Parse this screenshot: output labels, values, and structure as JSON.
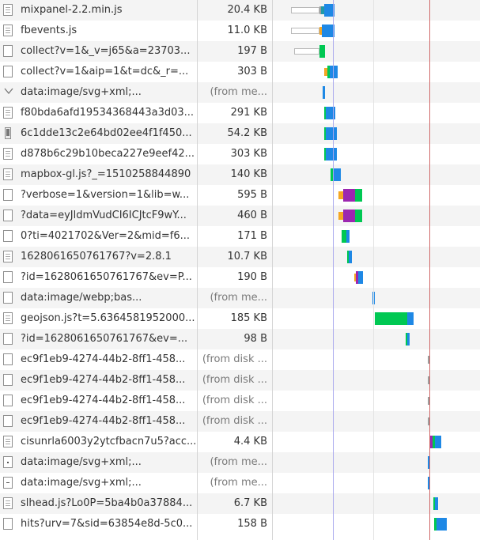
{
  "requests": [
    {
      "name": "mixpanel-2.2.min.js",
      "size": "20.4 KB",
      "icon": "doc-icon"
    },
    {
      "name": "fbevents.js",
      "size": "11.0 KB",
      "icon": "doc-icon"
    },
    {
      "name": "collect?v=1&_v=j65&a=23703...",
      "size": "197 B",
      "icon": "file-icon"
    },
    {
      "name": "collect?v=1&aip=1&t=dc&_r=...",
      "size": "303 B",
      "icon": "file-icon"
    },
    {
      "name": "data:image/svg+xml;...",
      "size": "(from me...",
      "icon": "chevron-down-icon"
    },
    {
      "name": "f80bda6afd19534368443a3d03...",
      "size": "291 KB",
      "icon": "doc-icon"
    },
    {
      "name": "6c1dde13c2e64bd02ee4f1f450...",
      "size": "54.2 KB",
      "icon": "phone-icon"
    },
    {
      "name": "d878b6c29b10beca227e9eef42...",
      "size": "303 KB",
      "icon": "doc-icon"
    },
    {
      "name": "mapbox-gl.js?_=1510258844890",
      "size": "140 KB",
      "icon": "doc-icon"
    },
    {
      "name": "?verbose=1&version=1&lib=w...",
      "size": "595 B",
      "icon": "file-icon"
    },
    {
      "name": "?data=eyJldmVudCI6ICJtcF9wY...",
      "size": "460 B",
      "icon": "file-icon"
    },
    {
      "name": "0?ti=4021702&Ver=2&mid=f6...",
      "size": "171 B",
      "icon": "file-icon"
    },
    {
      "name": "1628061650761767?v=2.8.1",
      "size": "10.7 KB",
      "icon": "doc-icon"
    },
    {
      "name": "?id=1628061650761767&ev=P...",
      "size": "190 B",
      "icon": "file-icon"
    },
    {
      "name": "data:image/webp;bas...",
      "size": "(from me...",
      "icon": "file-icon"
    },
    {
      "name": "geojson.js?t=5.6364581952000...",
      "size": "185 KB",
      "icon": "doc-icon"
    },
    {
      "name": "?id=1628061650761767&ev=...",
      "size": "98 B",
      "icon": "file-icon"
    },
    {
      "name": "ec9f1eb9-4274-44b2-8ff1-458...",
      "size": "(from disk ...",
      "icon": "file-icon"
    },
    {
      "name": "ec9f1eb9-4274-44b2-8ff1-458...",
      "size": "(from disk ...",
      "icon": "file-icon"
    },
    {
      "name": "ec9f1eb9-4274-44b2-8ff1-458...",
      "size": "(from disk ...",
      "icon": "file-icon"
    },
    {
      "name": "ec9f1eb9-4274-44b2-8ff1-458...",
      "size": "(from disk ...",
      "icon": "file-icon"
    },
    {
      "name": "cisunrla6003y2ytcfbacn7u5?acc...",
      "size": "4.4 KB",
      "icon": "doc-icon"
    },
    {
      "name": "data:image/svg+xml;...",
      "size": "(from me...",
      "icon": "dot-icon"
    },
    {
      "name": "data:image/svg+xml;...",
      "size": "(from me...",
      "icon": "dash-icon"
    },
    {
      "name": "slhead.js?Lo0P=5ba4b0a37884...",
      "size": "6.7 KB",
      "icon": "doc-icon"
    },
    {
      "name": "hits?urv=7&sid=63854e8d-5c0...",
      "size": "158 B",
      "icon": "file-icon"
    }
  ],
  "colors": {
    "stalled": "#ffffff",
    "blocked": "#9e9e9e",
    "dns": "#1f9aa8",
    "connect": "#f5a623",
    "ssl": "#9c27b0",
    "waiting": "#00c853",
    "download": "#1e88e5",
    "dom_content_loaded_line": "#aaa9ee",
    "load_line": "#d06a6a"
  }
}
